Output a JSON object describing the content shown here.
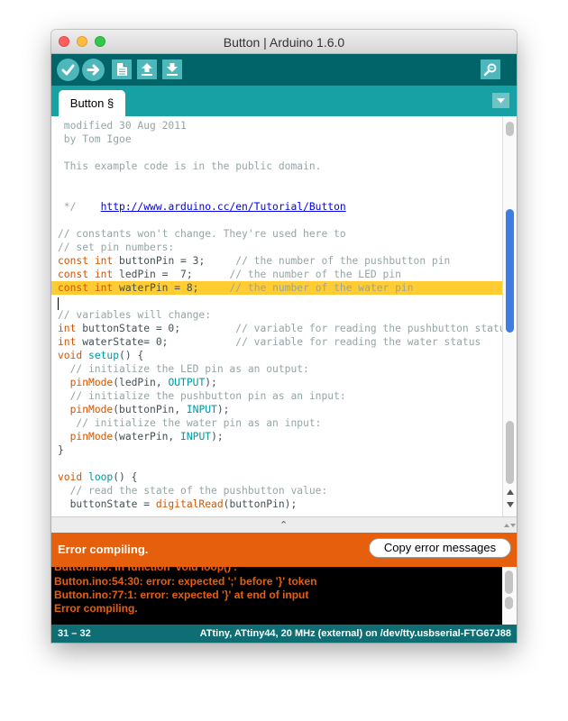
{
  "window": {
    "title": "Button | Arduino 1.6.0"
  },
  "toolbar": {
    "buttons": [
      "verify-icon",
      "upload-icon",
      "new-icon",
      "open-icon",
      "save-icon"
    ],
    "serial_monitor": "magnifier-icon"
  },
  "tabs": [
    {
      "label": "Button §"
    }
  ],
  "editor": {
    "l1": " modified 30 Aug 2011",
    "l2": " by Tom Igoe",
    "l3": " This example code is in the public domain.",
    "url": "http://www.arduino.cc/en/Tutorial/Button",
    "l4": " */",
    "l5": "// constants won't change. They're used here to",
    "l6": "// set pin numbers:",
    "l7_name": "buttonPin = 3;",
    "l7_cmt": "// the number of the pushbutton pin",
    "l8_name": "ledPin =  7;",
    "l8_cmt": "// the number of the LED pin",
    "l9_name": "waterPin = 8;",
    "l9_cmt": "// the number of the water pin",
    "l10": "// variables will change:",
    "l11_name": "buttonState = 0;",
    "l11_cmt": "// variable for reading the pushbutton status",
    "l12_name": "waterState= 0;",
    "l12_cmt": "// variable for reading the water status",
    "l13_type": "void",
    "l13_fn": "setup",
    "l13_rest": "() {",
    "l14": "  // initialize the LED pin as an output:",
    "l15_fn": "pinMode",
    "l15_args": "(ledPin, ",
    "l15_const": "OUTPUT",
    "l15_end": ");",
    "l16": "  // initialize the pushbutton pin as an input:",
    "l17_fn": "pinMode",
    "l17_args": "(buttonPin, ",
    "l17_const": "INPUT",
    "l17_end": ");",
    "l18": "   // initialize the water pin as an input:",
    "l19_fn": "pinMode",
    "l19_args": "(waterPin, ",
    "l19_const": "INPUT",
    "l19_end": ");",
    "l20": "}",
    "l21_type": "void",
    "l21_fn": "loop",
    "l21_rest": "() {",
    "l22": "  // read the state of the pushbutton value:",
    "l23_var": "buttonState = ",
    "l23_fn": "digitalRead",
    "l23_end": "(buttonPin);",
    "kw_const": "const",
    "kw_int": "int"
  },
  "divider": {
    "handle": "⌃"
  },
  "status": {
    "message": "Error compiling.",
    "copy_button": "Copy error messages"
  },
  "console": {
    "line0": "Button.ino: In function 'void loop()':",
    "line1": "Button.ino:54:30: error: expected ';' before '}' token",
    "line2": "Button.ino:77:1: error: expected '}' at end of input",
    "line3": "Error compiling."
  },
  "footer": {
    "lines": "31 – 32",
    "board": "ATtiny, ATtiny44, 20 MHz (external) on /dev/tty.usbserial-FTG67J88"
  },
  "colors": {
    "accent": "#006468",
    "tab_bar": "#17a1a5",
    "error": "#e65f0c",
    "highlight": "#ffcc33"
  }
}
